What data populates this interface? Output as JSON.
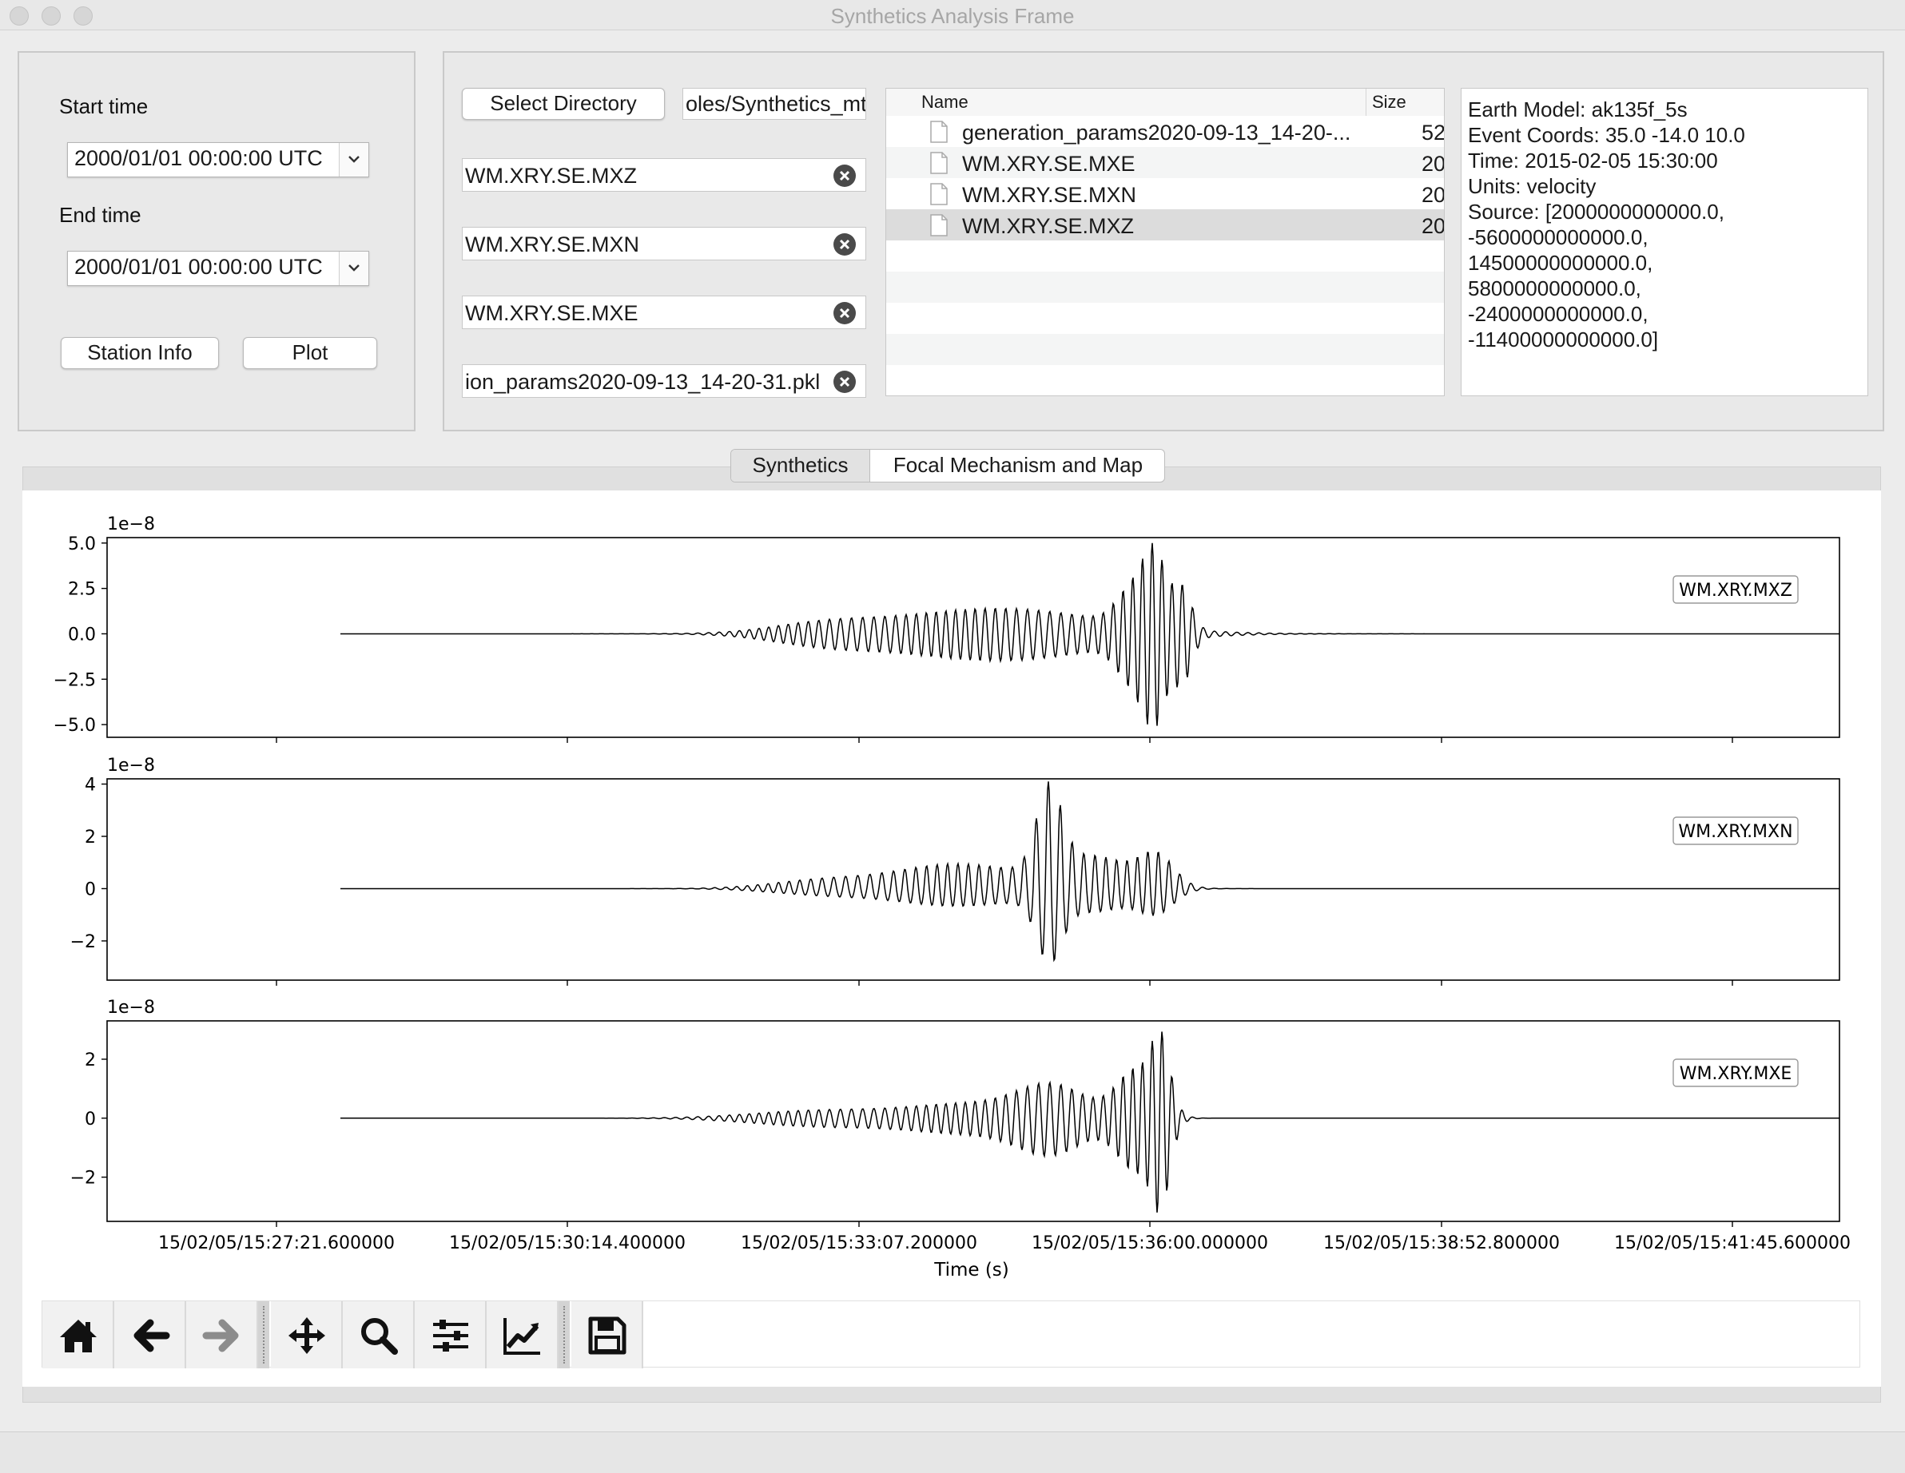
{
  "window": {
    "title": "Synthetics Analysis Frame"
  },
  "time_panel": {
    "start_label": "Start time",
    "start_value": "2000/01/01 00:00:00 UTC",
    "end_label": "End time",
    "end_value": "2000/01/01 00:00:00 UTC",
    "station_info_button": "Station Info",
    "plot_button": "Plot"
  },
  "file_panel": {
    "select_directory_button": "Select Directory",
    "directory_value": "oles/Synthetics_mti",
    "selected_files": [
      "WM.XRY.SE.MXZ",
      "WM.XRY.SE.MXN",
      "WM.XRY.SE.MXE",
      "ion_params2020-09-13_14-20-31.pkl"
    ],
    "list_headers": {
      "name": "Name",
      "size": "Size"
    },
    "files": [
      {
        "name": "generation_params2020-09-13_14-20-...",
        "size": "52"
      },
      {
        "name": "WM.XRY.SE.MXE",
        "size": "20"
      },
      {
        "name": "WM.XRY.SE.MXN",
        "size": "20"
      },
      {
        "name": "WM.XRY.SE.MXZ",
        "size": "20"
      }
    ],
    "selected_row": 3
  },
  "info_panel": {
    "lines": [
      "Earth Model: ak135f_5s",
      "Event Coords: 35.0 -14.0 10.0",
      "Time: 2015-02-05 15:30:00",
      "Units: velocity",
      "Source: [2000000000000.0,",
      "-5600000000000.0,",
      "14500000000000.0,",
      "5800000000000.0,",
      "-2400000000000.0,",
      "-11400000000000.0]"
    ]
  },
  "tabs": [
    {
      "label": "Synthetics",
      "active": true
    },
    {
      "label": "Focal Mechanism and Map",
      "active": false
    }
  ],
  "chart_data": [
    {
      "type": "line",
      "legend": "WM.XRY.MXZ",
      "legend_position": "top-right",
      "scale_label": "1e−8",
      "yticks": [
        "5.0",
        "2.5",
        "0.0",
        "−2.5",
        "−5.0"
      ],
      "ylim": [
        -5.7,
        5.3
      ],
      "approx_peak": 5.0,
      "approx_trough": -5.3
    },
    {
      "type": "line",
      "legend": "WM.XRY.MXN",
      "legend_position": "top-right",
      "scale_label": "1e−8",
      "yticks": [
        "4",
        "2",
        "0",
        "−2"
      ],
      "ylim": [
        -3.5,
        4.2
      ],
      "approx_peak": 4.1,
      "approx_trough": -2.9
    },
    {
      "type": "line",
      "legend": "WM.XRY.MXE",
      "legend_position": "top-right",
      "scale_label": "1e−8",
      "yticks": [
        "2",
        "0",
        "−2"
      ],
      "ylim": [
        -3.5,
        3.3
      ],
      "approx_peak": 3.0,
      "approx_trough": -3.2,
      "xlabel": "Time (s)",
      "xticks": [
        "15/02/05/15:27:21.600000",
        "15/02/05/15:30:14.400000",
        "15/02/05/15:33:07.200000",
        "15/02/05/15:36:00.000000",
        "15/02/05/15:38:52.800000",
        "15/02/05/15:41:45.600000"
      ]
    }
  ],
  "toolbar": [
    "home-icon",
    "back-arrow-icon",
    "forward-arrow-icon",
    "pan-icon",
    "zoom-icon",
    "configure-subplots-icon",
    "edit-curves-icon",
    "save-icon"
  ]
}
